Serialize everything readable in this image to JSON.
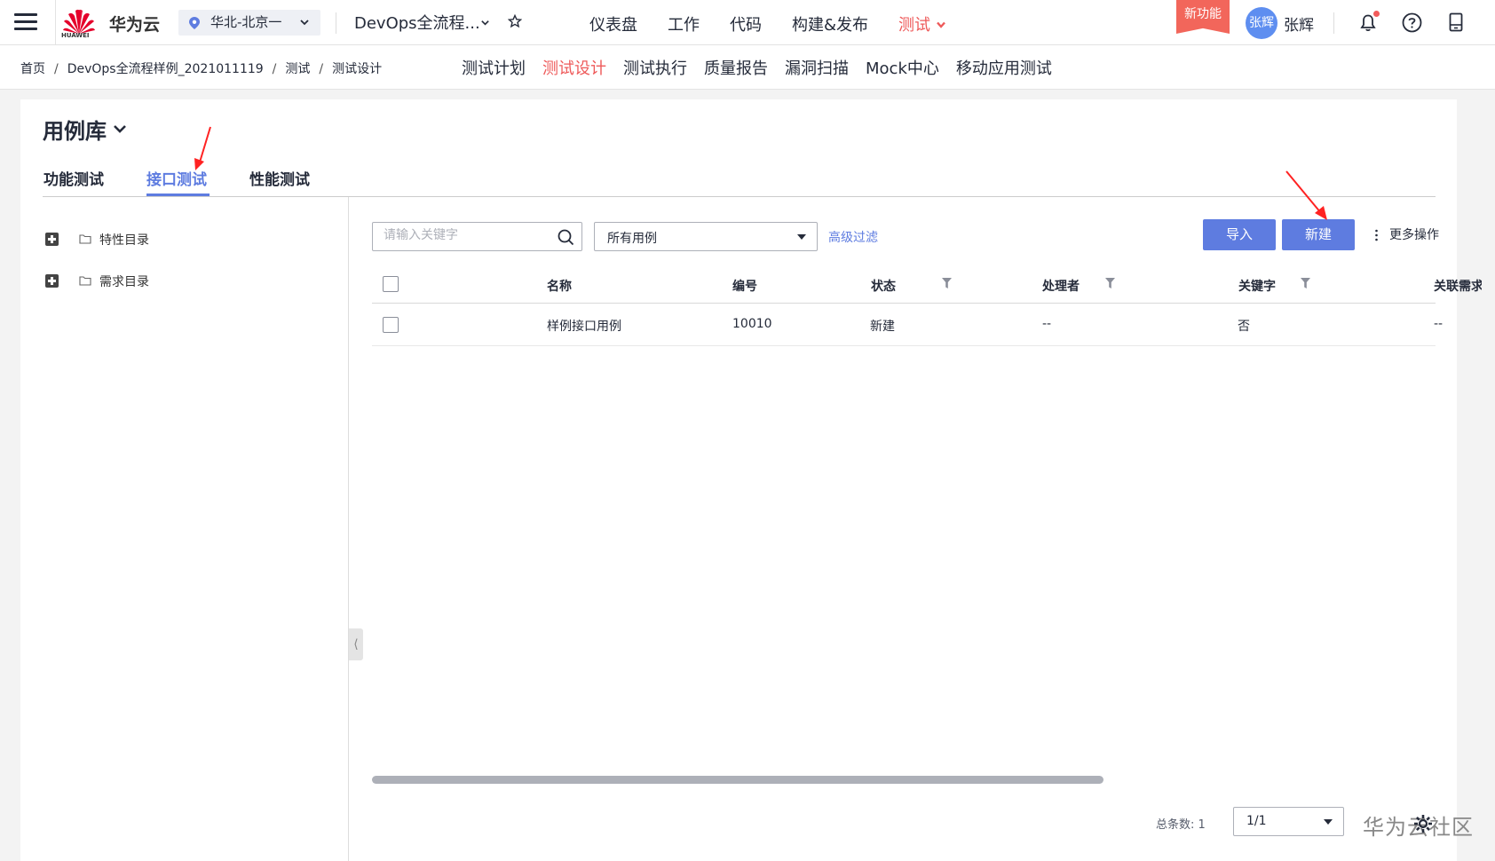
{
  "topbar": {
    "logo_small": "HUAWEI",
    "logo_text": "华为云",
    "region": "华北-北京一",
    "project": "DevOps全流程...",
    "nav": [
      {
        "label": "仪表盘"
      },
      {
        "label": "工作"
      },
      {
        "label": "代码"
      },
      {
        "label": "构建&发布"
      },
      {
        "label": "测试"
      }
    ],
    "new_feature": "新功能",
    "avatar_text": "张辉",
    "username": "张辉"
  },
  "subbar": {
    "breadcrumb": [
      "首页",
      "DevOps全流程样例_2021011119",
      "测试",
      "测试设计"
    ],
    "tabs": [
      {
        "label": "测试计划"
      },
      {
        "label": "测试设计"
      },
      {
        "label": "测试执行"
      },
      {
        "label": "质量报告"
      },
      {
        "label": "漏洞扫描"
      },
      {
        "label": "Mock中心"
      },
      {
        "label": "移动应用测试"
      }
    ],
    "active_tab": "测试设计"
  },
  "library": {
    "title": "用例库",
    "tabs": [
      {
        "label": "功能测试"
      },
      {
        "label": "接口测试"
      },
      {
        "label": "性能测试"
      }
    ],
    "active_tab": "接口测试"
  },
  "tree": [
    {
      "label": "特性目录"
    },
    {
      "label": "需求目录"
    }
  ],
  "toolbar": {
    "search_placeholder": "请输入关键字",
    "filter_select": "所有用例",
    "advanced_filter": "高级过滤",
    "import_label": "导入",
    "new_label": "新建",
    "more_label": "更多操作"
  },
  "table": {
    "columns": [
      "名称",
      "编号",
      "状态",
      "处理者",
      "关键字",
      "关联需求"
    ],
    "rows": [
      {
        "name": "样例接口用例",
        "id": "10010",
        "status": "新建",
        "owner": "--",
        "keyword": "否",
        "linked": "--"
      }
    ]
  },
  "footer": {
    "total": "总条数: 1",
    "page": "1/1"
  },
  "watermark": "华为云社区",
  "colors": {
    "accent": "#5e7ce0",
    "active_nav": "#ee5a5a",
    "new_badge": "#f2665b"
  }
}
